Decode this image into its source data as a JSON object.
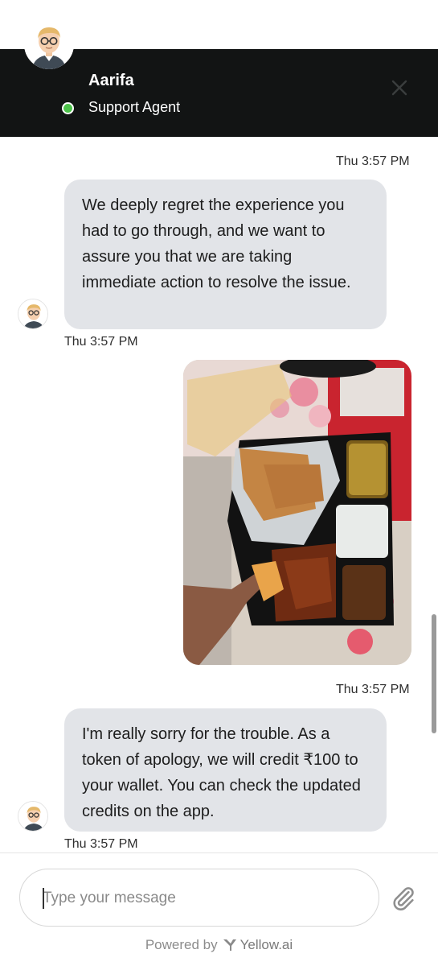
{
  "header": {
    "agent_name": "Aarifa",
    "agent_role": "Support Agent",
    "close_icon": "close-icon",
    "status_color": "#4cc24a",
    "background_color": "#121414"
  },
  "messages": [
    {
      "type": "timestamp",
      "text": "Thu 3:57 PM"
    },
    {
      "type": "agent_text",
      "text": "We deeply regret the experience you had to go through, and we want to assure you that we are taking immediate action to resolve the issue.",
      "time": "Thu 3:57 PM"
    },
    {
      "type": "user_image",
      "time": "Thu 3:57 PM"
    },
    {
      "type": "agent_text",
      "text": "I'm really sorry for the trouble. As a token of apology, we will credit ₹100 to your wallet. You can check the updated credits on the app.",
      "time": "Thu 3:57 PM"
    }
  ],
  "composer": {
    "placeholder": "Type your message",
    "attach_icon": "paperclip-icon"
  },
  "footer": {
    "powered_by": "Powered by",
    "brand": "Yellow.ai"
  }
}
